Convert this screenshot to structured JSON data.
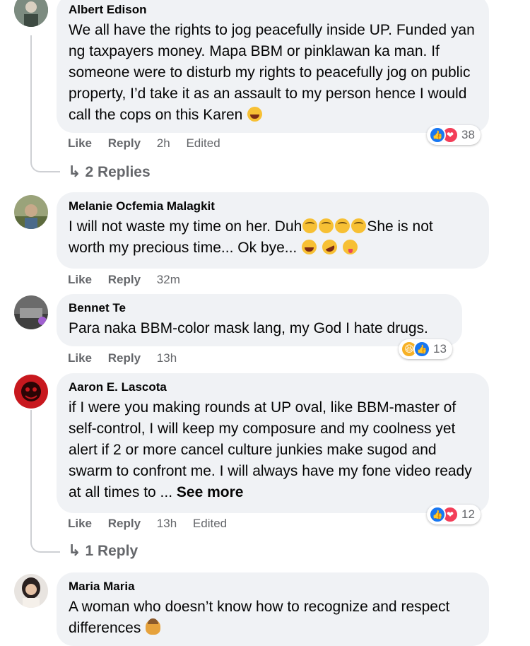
{
  "comments": [
    {
      "author": "Albert Edison",
      "text": "We all have the rights to jog peacefully inside UP. Funded yan ng taxpayers money. Mapa BBM or pinklawan ka man. If someone were to disturb my rights to peacefully jog on public property, I’d take it as an assault to my person hence I would call the cops on this Karen",
      "like_label": "Like",
      "reply_label": "Reply",
      "time": "2h",
      "edited": "Edited",
      "reaction_count": "38",
      "replies_label": "2 Replies"
    },
    {
      "author": "Melanie Ocfemia Malagkit",
      "text_line1": "I will not waste my time on her. Duh",
      "text_line1b": "She is not",
      "text_line2": "worth my precious time... Ok bye...",
      "like_label": "Like",
      "reply_label": "Reply",
      "time": "32m"
    },
    {
      "author": "Bennet Te",
      "text": "Para naka BBM-color mask lang, my God I hate drugs.",
      "like_label": "Like",
      "reply_label": "Reply",
      "time": "13h",
      "reaction_count": "13"
    },
    {
      "author": "Aaron E. Lascota",
      "text": "if I were you making rounds at UP oval, like BBM-master of self-control, I will keep my composure and my coolness yet alert if 2 or more cancel culture junkies make sugod and swarm to confront me. I will always have my fone video ready at all times to ...",
      "see_more": "See more",
      "like_label": "Like",
      "reply_label": "Reply",
      "time": "13h",
      "edited": "Edited",
      "reaction_count": "12",
      "replies_label": "1 Reply"
    },
    {
      "author": "Maria Maria",
      "text": "A woman who doesn’t know how to recognize and respect differences"
    }
  ],
  "icons": {
    "reply_arrow": "reply-arrow-icon",
    "like": "like-reaction-icon",
    "love": "love-reaction-icon",
    "haha": "haha-reaction-icon"
  },
  "colors": {
    "bubble": "#f0f2f5",
    "meta_text": "#65676b",
    "like_blue": "#1877f2",
    "love_red": "#f33e58",
    "haha_yellow": "#f7b125"
  }
}
